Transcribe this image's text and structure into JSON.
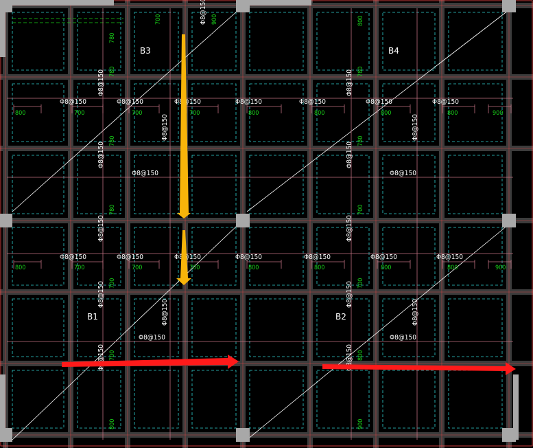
{
  "colors": {
    "background": "#000000",
    "beam": "#3c3c3c",
    "column": "#a8a8a8",
    "grid_red": "#ff4a4a",
    "rebar_dim": "#c07080",
    "stirrup_cyan": "#2fd1d1",
    "dim_green": "#19d219",
    "text_white": "#ffffff",
    "arrow_yellow": "#f7b40a",
    "arrow_red": "#ff1a1a"
  },
  "slabs": [
    {
      "id": "B3",
      "label": "B3"
    },
    {
      "id": "B4",
      "label": "B4"
    },
    {
      "id": "B1",
      "label": "B1"
    },
    {
      "id": "B2",
      "label": "B2"
    }
  ],
  "rebar_h": [
    "Φ8@150",
    "Φ8@150",
    "Φ8@150",
    "Φ8@150",
    "Φ8@150",
    "Φ8@150",
    "Φ8@150",
    "Φ8@150",
    "Φ8@150",
    "Φ8@150",
    "Φ8@150",
    "Φ8@150",
    "Φ8@150",
    "Φ8@150",
    "Φ8@150",
    "Φ8@150",
    "Φ8@150",
    "Φ8@150"
  ],
  "rebar_v": [
    "Φ8@150",
    "Φ8@150",
    "Φ8@150",
    "Φ8@150",
    "Φ8@150",
    "Φ8@150",
    "Φ8@150",
    "Φ8@150",
    "Φ8@150",
    "Φ8@150",
    "Φ8@150",
    "Φ8@150",
    "Φ8@150",
    "Φ8@150",
    "Φ8@150"
  ],
  "dims_h": [
    "800",
    "700",
    "700",
    "700",
    "800",
    "800",
    "800",
    "800",
    "900",
    "800",
    "700",
    "700",
    "700",
    "800",
    "800",
    "800",
    "800",
    "900"
  ],
  "dims_v": [
    "700",
    "900",
    "780",
    "780",
    "780",
    "780",
    "700",
    "700",
    "800",
    "800",
    "780",
    "780",
    "700",
    "700",
    "800",
    "900"
  ]
}
